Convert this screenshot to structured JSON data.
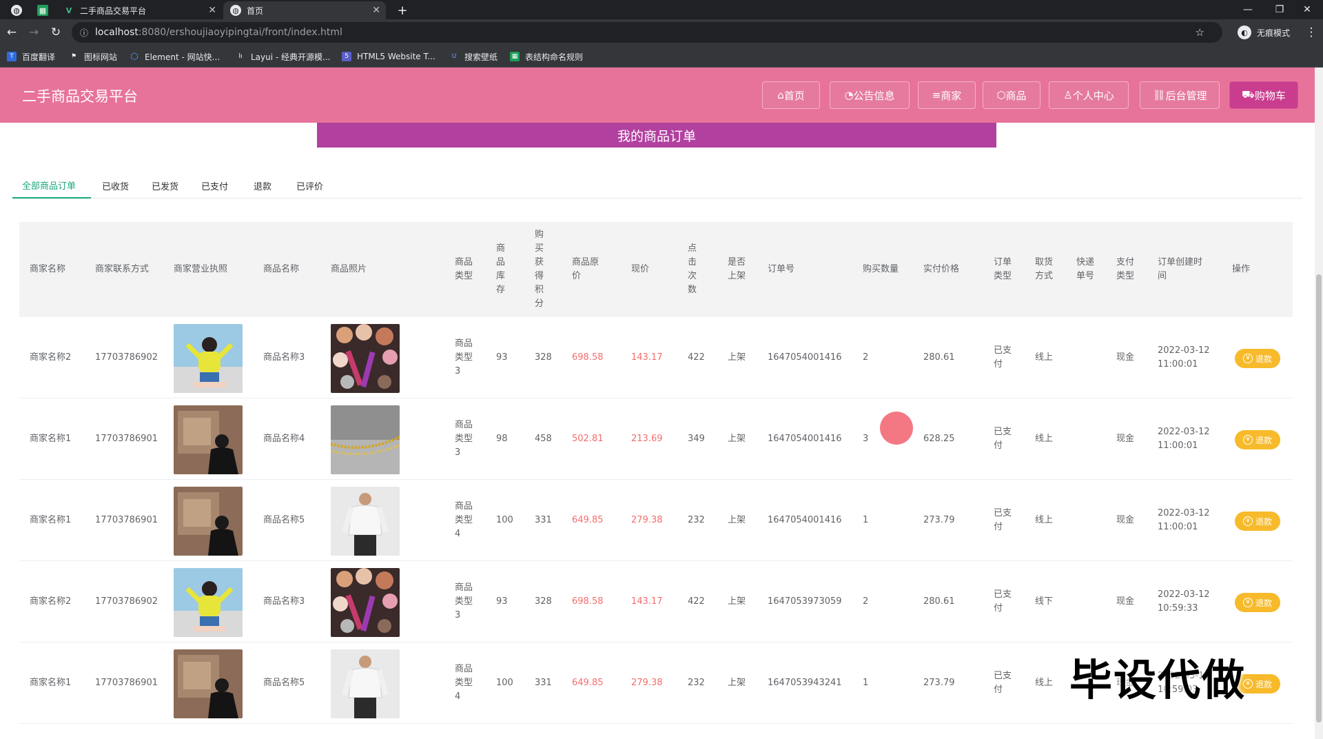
{
  "browser": {
    "tabs": [
      {
        "title": ""
      },
      {
        "title": ""
      },
      {
        "title": "二手商品交易平台"
      },
      {
        "title": "首页"
      }
    ],
    "url_host": "localhost",
    "url_rest": ":8080/ershoujiaoyipingtai/front/index.html",
    "incognito_label": "无痕模式",
    "bookmarks": [
      {
        "label": "百度翻译",
        "icon": "translate-icon",
        "color": "#2f6bde"
      },
      {
        "label": "图标网站",
        "icon": "flag-icon",
        "color": "#ffffff"
      },
      {
        "label": "Element - 网站快...",
        "icon": "hexagon-icon",
        "color": "#409eff"
      },
      {
        "label": "Layui - 经典开源模...",
        "icon": "layui-icon",
        "color": "#ffffff"
      },
      {
        "label": "HTML5 Website T...",
        "icon": "html5-icon",
        "color": "#5b5fc7"
      },
      {
        "label": "搜索壁纸",
        "icon": "wallpaper-icon",
        "color": "#3a7bd5"
      },
      {
        "label": "表结构命名规则",
        "icon": "sheet-icon",
        "color": "#1e9e5a"
      }
    ]
  },
  "site": {
    "title": "二手商品交易平台",
    "nav": [
      {
        "label": "首页",
        "icon": "home-icon"
      },
      {
        "label": "公告信息",
        "icon": "notice-icon"
      },
      {
        "label": "商家",
        "icon": "shop-icon"
      },
      {
        "label": "商品",
        "icon": "goods-icon"
      },
      {
        "label": "个人中心",
        "icon": "user-icon"
      },
      {
        "label": "后台管理",
        "icon": "link-icon"
      },
      {
        "label": "购物车",
        "icon": "cart-icon"
      }
    ],
    "accent_color": "#e7739a",
    "banner": "我的商品订单"
  },
  "order_tabs": [
    "全部商品订单",
    "已收货",
    "已发货",
    "已支付",
    "退款",
    "已评价"
  ],
  "table": {
    "headers": [
      "商家名称",
      "商家联系方式",
      "商家营业执照",
      "商品名称",
      "商品照片",
      "商品类型",
      "商品库存",
      "购买获得积分",
      "商品原价",
      "现价",
      "点击次数",
      "是否上架",
      "订单号",
      "购买数量",
      "实付价格",
      "订单类型",
      "取货方式",
      "快递单号",
      "支付类型",
      "订单创建时间",
      "操作"
    ],
    "rows": [
      {
        "shop": "商家名称2",
        "phone": "17703786902",
        "license": "woman-photo",
        "name": "商品名称3",
        "photo": "makeup-photo",
        "type": "商品类型3",
        "stock": "93",
        "points": "328",
        "orig": "698.58",
        "price": "143.17",
        "clicks": "422",
        "onsale": "上架",
        "order_no": "1647054001416",
        "qty": "2",
        "paid": "280.61",
        "order_type": "已支付",
        "pickup": "线上",
        "express": "",
        "pay_type": "现金",
        "created": "2022-03-12 11:00:01",
        "action": "退款"
      },
      {
        "shop": "商家名称1",
        "phone": "17703786901",
        "license": "man-photo",
        "name": "商品名称4",
        "photo": "necklace-photo",
        "type": "商品类型3",
        "stock": "98",
        "points": "458",
        "orig": "502.81",
        "price": "213.69",
        "clicks": "349",
        "onsale": "上架",
        "order_no": "1647054001416",
        "qty": "3",
        "paid": "628.25",
        "order_type": "已支付",
        "pickup": "线上",
        "express": "",
        "pay_type": "现金",
        "created": "2022-03-12 11:00:01",
        "action": "退款"
      },
      {
        "shop": "商家名称1",
        "phone": "17703786901",
        "license": "man-photo",
        "name": "商品名称5",
        "photo": "shirt-photo",
        "type": "商品类型4",
        "stock": "100",
        "points": "331",
        "orig": "649.85",
        "price": "279.38",
        "clicks": "232",
        "onsale": "上架",
        "order_no": "1647054001416",
        "qty": "1",
        "paid": "273.79",
        "order_type": "已支付",
        "pickup": "线上",
        "express": "",
        "pay_type": "现金",
        "created": "2022-03-12 11:00:01",
        "action": "退款"
      },
      {
        "shop": "商家名称2",
        "phone": "17703786902",
        "license": "woman-photo",
        "name": "商品名称3",
        "photo": "makeup-photo",
        "type": "商品类型3",
        "stock": "93",
        "points": "328",
        "orig": "698.58",
        "price": "143.17",
        "clicks": "422",
        "onsale": "上架",
        "order_no": "1647053973059",
        "qty": "2",
        "paid": "280.61",
        "order_type": "已支付",
        "pickup": "线下",
        "express": "",
        "pay_type": "现金",
        "created": "2022-03-12 10:59:33",
        "action": "退款"
      },
      {
        "shop": "商家名称1",
        "phone": "17703786901",
        "license": "man-photo",
        "name": "商品名称5",
        "photo": "shirt-photo",
        "type": "商品类型4",
        "stock": "100",
        "points": "331",
        "orig": "649.85",
        "price": "279.38",
        "clicks": "232",
        "onsale": "上架",
        "order_no": "1647053943241",
        "qty": "1",
        "paid": "273.79",
        "order_type": "已支付",
        "pickup": "线上",
        "express": "",
        "pay_type": "现金",
        "created": "2022-03-12 10:59:03",
        "action": "退款"
      }
    ]
  },
  "watermark": "毕设代做"
}
